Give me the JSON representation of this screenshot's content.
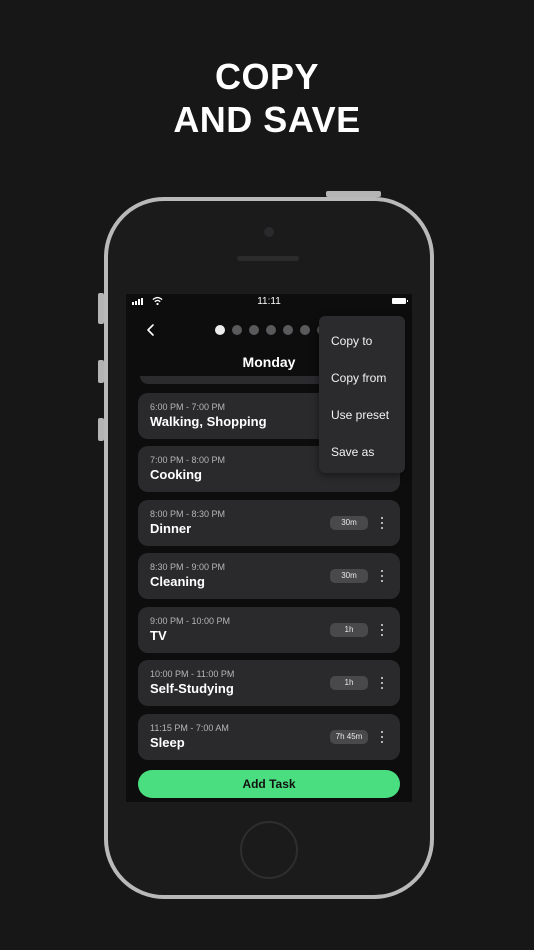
{
  "headline": {
    "line1": "COPY",
    "line2": "AND SAVE"
  },
  "status_bar": {
    "time": "11:11"
  },
  "header": {
    "day": "Monday",
    "page_dots": 7,
    "active_dot": 0
  },
  "tasks": [
    {
      "time": "6:00 PM - 7:00 PM",
      "name": "Walking, Shopping",
      "duration": ""
    },
    {
      "time": "7:00 PM - 8:00 PM",
      "name": "Cooking",
      "duration": ""
    },
    {
      "time": "8:00 PM - 8:30 PM",
      "name": "Dinner",
      "duration": "30m"
    },
    {
      "time": "8:30 PM - 9:00 PM",
      "name": "Cleaning",
      "duration": "30m"
    },
    {
      "time": "9:00 PM - 10:00 PM",
      "name": "TV",
      "duration": "1h"
    },
    {
      "time": "10:00 PM - 11:00 PM",
      "name": "Self-Studying",
      "duration": "1h"
    },
    {
      "time": "11:15 PM - 7:00 AM",
      "name": "Sleep",
      "duration": "7h 45m"
    }
  ],
  "menu": {
    "items": [
      "Copy to",
      "Copy from",
      "Use preset",
      "Save as"
    ]
  },
  "add_button": {
    "label": "Add Task"
  },
  "colors": {
    "accent": "#4ade80",
    "background": "#171717",
    "card": "#2a2a2d",
    "menu": "#2b2b2e"
  }
}
